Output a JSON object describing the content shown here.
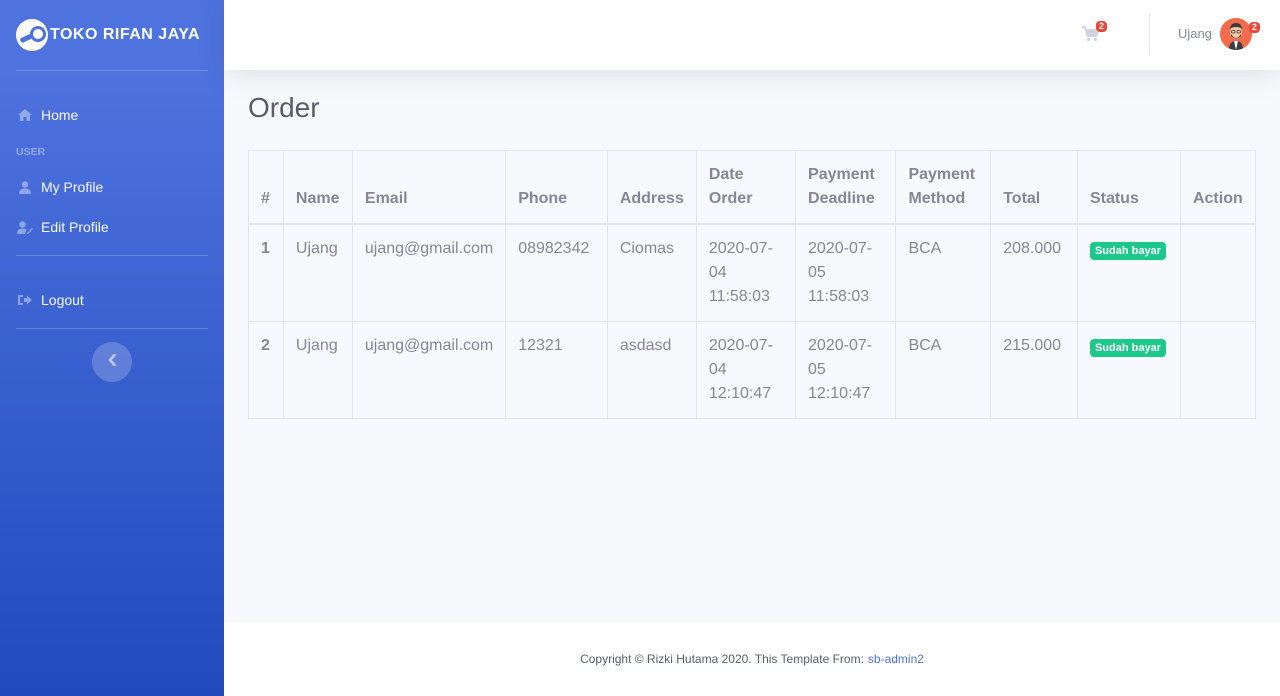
{
  "brand": {
    "name": "TOKO RIFAN JAYA"
  },
  "sidebar": {
    "home_label": "Home",
    "heading": "USER",
    "items": [
      {
        "label": "My Profile"
      },
      {
        "label": "Edit Profile"
      }
    ],
    "logout_label": "Logout"
  },
  "topbar": {
    "cart_count": "2",
    "user_name": "Ujang",
    "alert_count": "2"
  },
  "page": {
    "title": "Order"
  },
  "table": {
    "headers": [
      "#",
      "Name",
      "Email",
      "Phone",
      "Address",
      "Date Order",
      "Payment Deadline",
      "Payment Method",
      "Total",
      "Status",
      "Action"
    ],
    "rows": [
      {
        "no": "1",
        "name": "Ujang",
        "email": "ujang@gmail.com",
        "phone": "08982342",
        "address": "Ciomas",
        "date_order": "2020-07-04 11:58:03",
        "deadline": "2020-07-05 11:58:03",
        "method": "BCA",
        "total": "208.000",
        "status": "Sudah bayar"
      },
      {
        "no": "2",
        "name": "Ujang",
        "email": "ujang@gmail.com",
        "phone": "12321",
        "address": "asdasd",
        "date_order": "2020-07-04 12:10:47",
        "deadline": "2020-07-05 12:10:47",
        "method": "BCA",
        "total": "215.000",
        "status": "Sudah bayar"
      }
    ]
  },
  "footer": {
    "text": "Copyright © Rizki Hutama 2020. This Template From:",
    "link": "sb-admin2"
  },
  "colors": {
    "primary": "#4e73df",
    "success": "#1cc88a",
    "danger": "#e74a3b"
  }
}
